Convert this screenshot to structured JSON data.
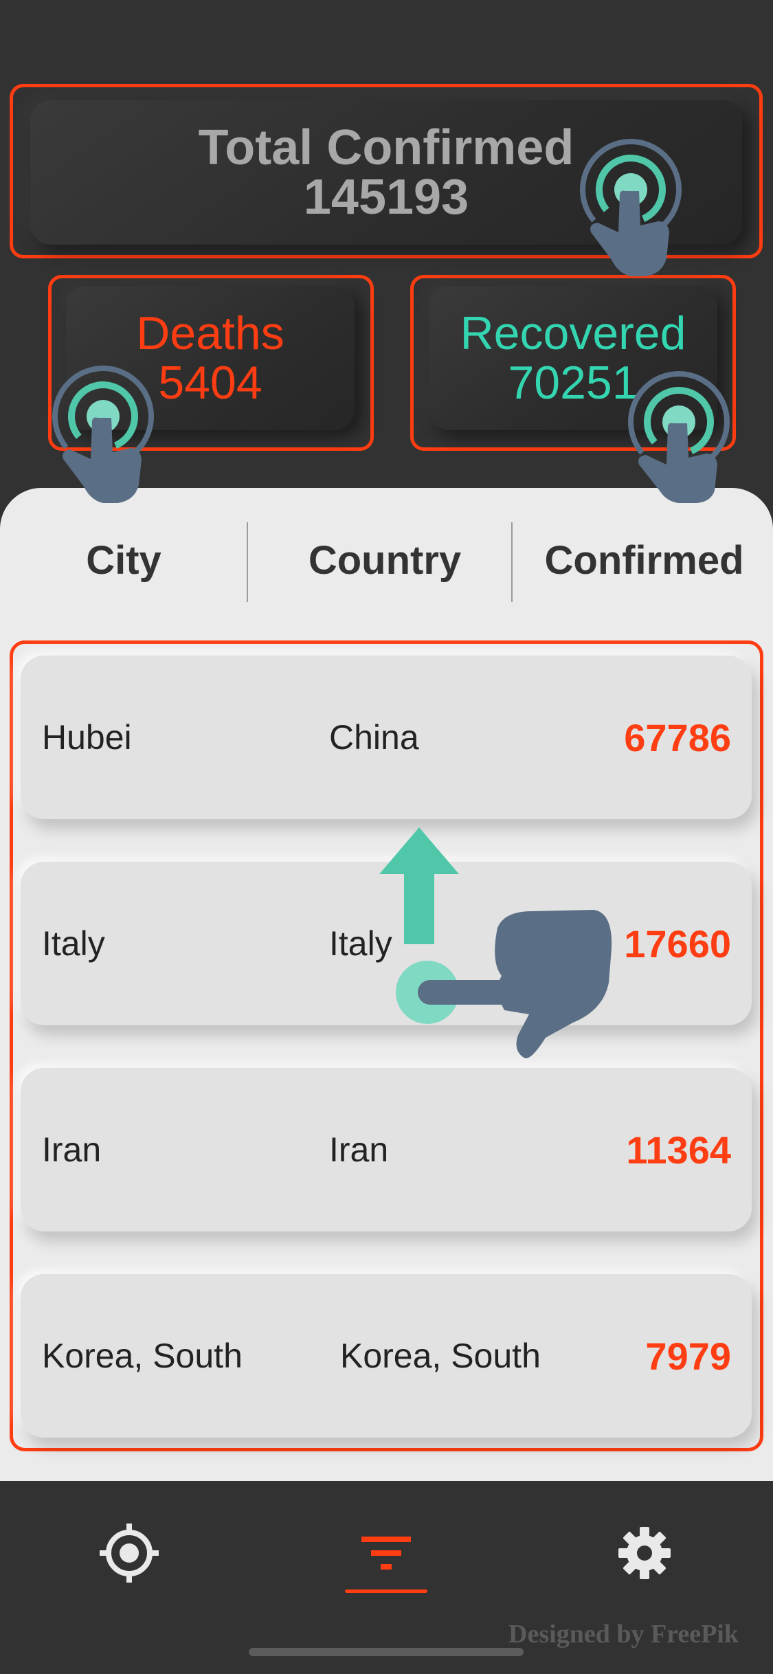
{
  "stats": {
    "total": {
      "label": "Total Confirmed",
      "value": "145193"
    },
    "deaths": {
      "label": "Deaths",
      "value": "5404"
    },
    "recovered": {
      "label": "Recovered",
      "value": "70251"
    }
  },
  "table": {
    "headers": [
      "City",
      "Country",
      "Confirmed"
    ],
    "rows": [
      {
        "city": "Hubei",
        "country": "China",
        "confirmed": "67786"
      },
      {
        "city": "Italy",
        "country": "Italy",
        "confirmed": "17660"
      },
      {
        "city": "Iran",
        "country": "Iran",
        "confirmed": "11364"
      },
      {
        "city": "Korea, South",
        "country": "Korea, South",
        "confirmed": "7979"
      }
    ]
  },
  "nav": {
    "items": [
      {
        "icon": "location-target-icon",
        "active": false
      },
      {
        "icon": "filter-icon",
        "active": true
      },
      {
        "icon": "gear-icon",
        "active": false
      }
    ]
  },
  "footer": {
    "credit": "Designed by FreePik"
  },
  "colors": {
    "accent": "#ff3d12",
    "recovered": "#33d6b0",
    "background": "#323232",
    "panel": "#ebebeb",
    "gesture": "#5a6e85"
  }
}
